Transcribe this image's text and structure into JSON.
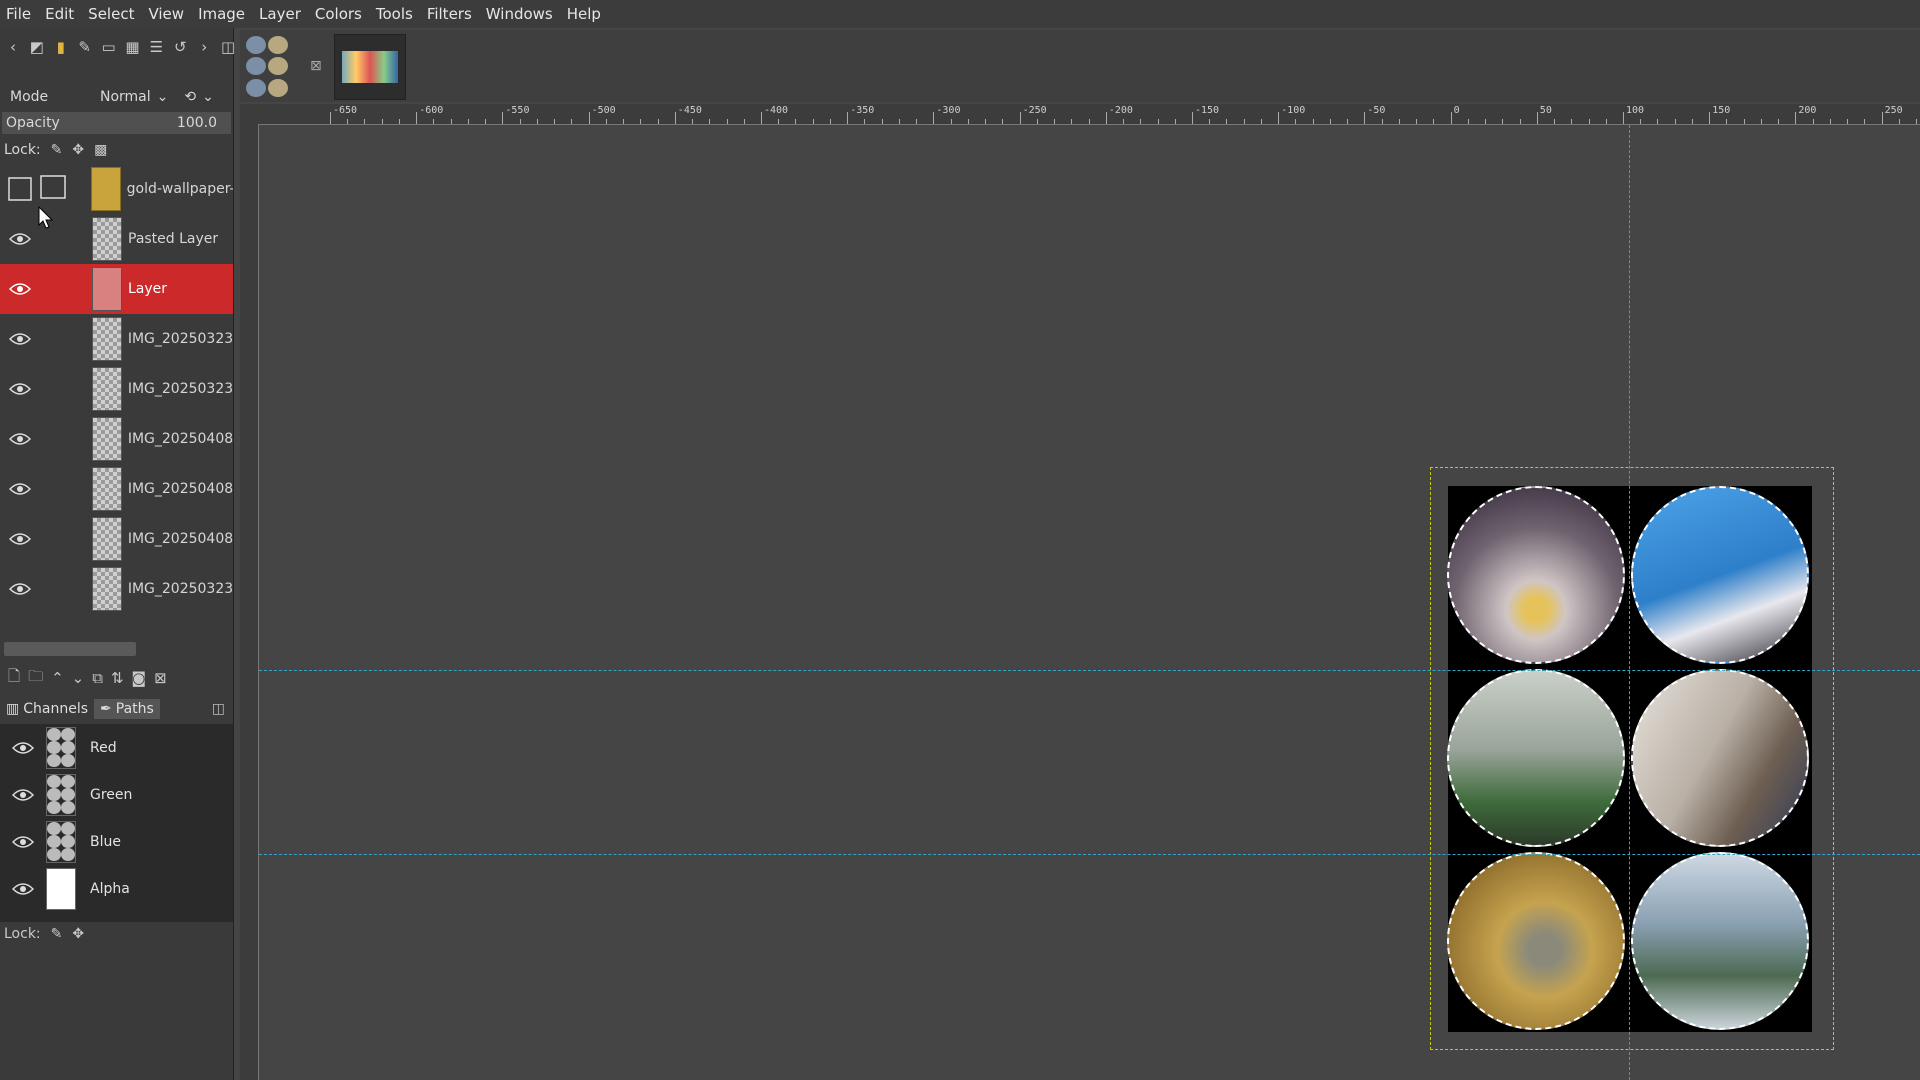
{
  "menu": [
    "File",
    "Edit",
    "Select",
    "View",
    "Image",
    "Layer",
    "Colors",
    "Tools",
    "Filters",
    "Windows",
    "Help"
  ],
  "layers_panel": {
    "mode_label": "Mode",
    "mode_value": "Normal",
    "opacity_label": "Opacity",
    "opacity_value": "100.0",
    "lock_label": "Lock:",
    "layers": [
      {
        "name": "gold-wallpaper-",
        "visible": false,
        "active": false
      },
      {
        "name": "Pasted Layer",
        "visible": true,
        "active": false
      },
      {
        "name": "Layer",
        "visible": true,
        "active": true
      },
      {
        "name": "IMG_20250323",
        "visible": true,
        "active": false
      },
      {
        "name": "IMG_20250323",
        "visible": true,
        "active": false
      },
      {
        "name": "IMG_20250408",
        "visible": true,
        "active": false
      },
      {
        "name": "IMG_20250408",
        "visible": true,
        "active": false
      },
      {
        "name": "IMG_20250408",
        "visible": true,
        "active": false
      },
      {
        "name": "IMG_20250323",
        "visible": true,
        "active": false
      }
    ]
  },
  "tabs": {
    "channels": "Channels",
    "paths": "Paths"
  },
  "channels": [
    {
      "name": "Red"
    },
    {
      "name": "Green"
    },
    {
      "name": "Blue"
    },
    {
      "name": "Alpha"
    }
  ],
  "channels_lock_label": "Lock:",
  "ruler": {
    "labels": [
      "-650",
      "-600",
      "-550",
      "-500",
      "-450",
      "-400",
      "-350",
      "-300",
      "-250",
      "-200",
      "-150",
      "-100",
      "-50",
      "0",
      "50",
      "100",
      "150",
      "200",
      "250"
    ]
  },
  "colors": {
    "active_layer": "#cc2a2a",
    "guide": "#2fa6c8",
    "layer_boundary": "#c8c800"
  }
}
